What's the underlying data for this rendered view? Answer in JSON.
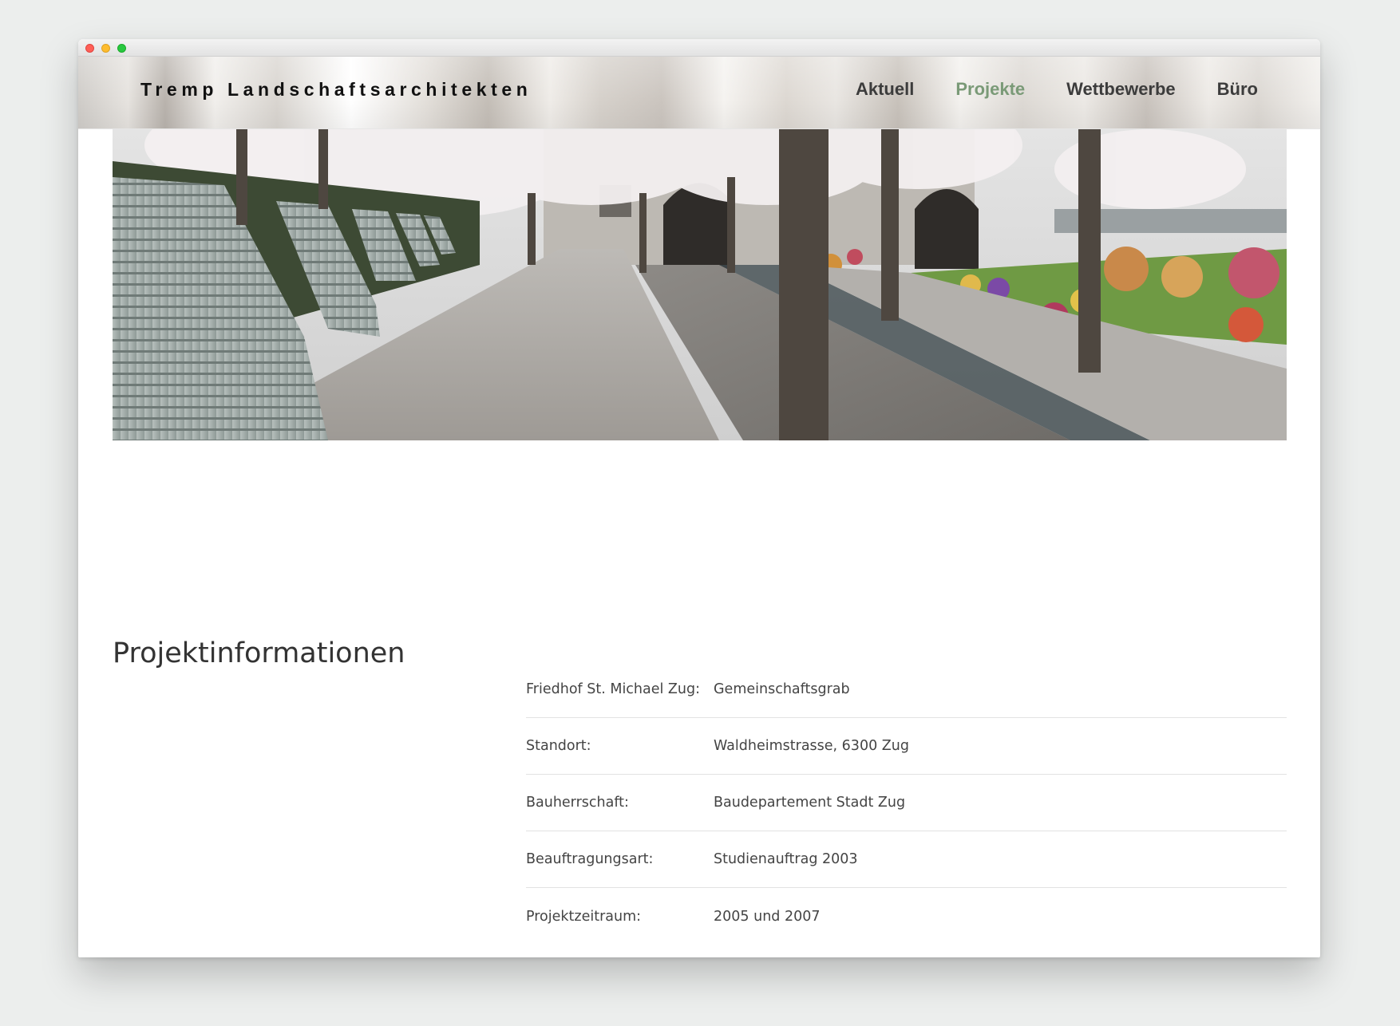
{
  "site": {
    "logo": "Tremp Landschaftsarchitekten",
    "accent_color": "#7a9a77"
  },
  "nav": {
    "items": [
      {
        "label": "Aktuell"
      },
      {
        "label": "Projekte",
        "active": true
      },
      {
        "label": "Wettbewerbe"
      },
      {
        "label": "Büro"
      }
    ]
  },
  "hero": {
    "alt": "Friedhof St. Michael Zug"
  },
  "project": {
    "heading": "Projektinformationen",
    "rows": [
      {
        "label": "Friedhof St. Michael Zug:",
        "value": "Gemeinschaftsgrab"
      },
      {
        "label": "Standort:",
        "value": "Waldheimstrasse, 6300 Zug"
      },
      {
        "label": "Bauherrschaft:",
        "value": "Baudepartement Stadt Zug"
      },
      {
        "label": "Beauftragungsart:",
        "value": "Studienauftrag 2003"
      },
      {
        "label": "Projektzeitraum:",
        "value": "2005 und 2007"
      }
    ]
  }
}
